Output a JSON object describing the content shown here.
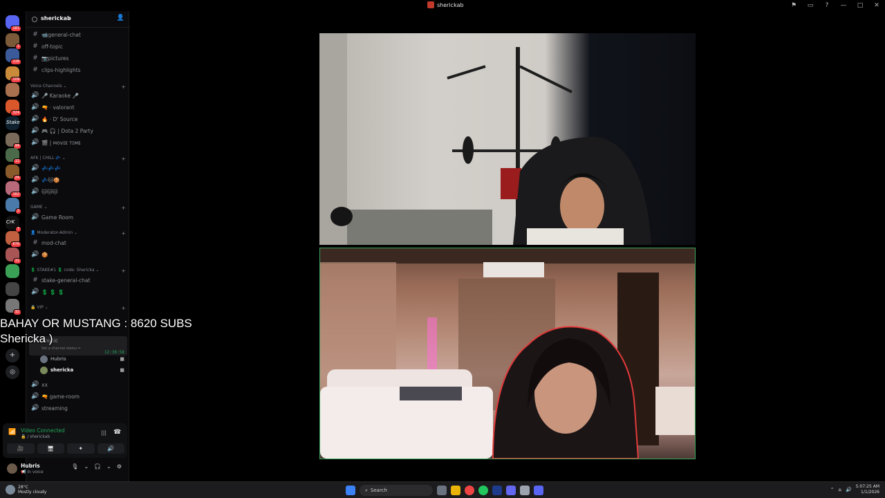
{
  "window": {
    "title": "sherickab",
    "controls": [
      "⚑",
      "▭",
      "?",
      "—",
      "□",
      "✕"
    ]
  },
  "rail": {
    "servers": [
      {
        "name": "home",
        "badge": "181",
        "color": "#5865f2"
      },
      {
        "name": "server-2",
        "badge": "1",
        "color": "#7b5a3a"
      },
      {
        "name": "server-3",
        "badge": "138",
        "color": "#3a5a9a"
      },
      {
        "name": "server-4",
        "badge": "109",
        "color": "#c98a3a"
      },
      {
        "name": "server-5",
        "badge": "",
        "color": "#a8704f"
      },
      {
        "name": "server-6",
        "badge": "324",
        "color": "#d9572b"
      },
      {
        "name": "Stake",
        "badge": "",
        "color": "#0f212e"
      },
      {
        "name": "server-8",
        "badge": "94",
        "color": "#7a6a5a"
      },
      {
        "name": "server-9",
        "badge": "12",
        "color": "#4a6a4a"
      },
      {
        "name": "server-10",
        "badge": "24",
        "color": "#8a5a2a"
      },
      {
        "name": "server-11",
        "badge": "162",
        "color": "#b86a7a"
      },
      {
        "name": "server-12",
        "badge": "2",
        "color": "#4a7aaa"
      },
      {
        "name": "CrK",
        "badge": "7",
        "color": "#111111"
      },
      {
        "name": "server-14",
        "badge": "676",
        "color": "#c06040"
      },
      {
        "name": "server-15",
        "badge": "11",
        "color": "#aa5555"
      },
      {
        "name": "server-16",
        "badge": "",
        "color": "#3aa055"
      },
      {
        "name": "server-17",
        "badge": "",
        "color": "#444444"
      },
      {
        "name": "server-18",
        "badge": "32",
        "color": "#777777"
      }
    ]
  },
  "guild": {
    "name": "sherickab"
  },
  "channels": {
    "text_top": [
      {
        "sym": "#",
        "label": "📹general-chat"
      },
      {
        "sym": "#",
        "label": "off-topic"
      },
      {
        "sym": "#",
        "label": "📷pictures"
      },
      {
        "sym": "#",
        "label": "clips-highlights"
      }
    ],
    "cat_voice": "Voice Channels ⌄",
    "voice": [
      {
        "sym": "🔊",
        "label": "🎤 Karaoke 🎤"
      },
      {
        "sym": "🔊",
        "label": "🔫 · valorant"
      },
      {
        "sym": "🔊",
        "label": "🔥 · D' Source"
      },
      {
        "sym": "🔊",
        "label": "🎮 🎧 | Dota 2 Party"
      },
      {
        "sym": "🔊",
        "label": "🎬 | ᴍᴏᴠɪᴇ ᴛɪᴍᴇ"
      }
    ],
    "cat_afk": "AFK | CHILL 💤 ⌄",
    "afk": [
      {
        "sym": "🔊",
        "label": "💤💤💤"
      },
      {
        "sym": "🔊",
        "label": "💤🐱🍪"
      },
      {
        "sym": "🔊",
        "label": "🐱🐱🐱"
      }
    ],
    "cat_game": "GAME ⌄",
    "game": [
      {
        "sym": "🔊",
        "label": "Game Room"
      }
    ],
    "cat_mod": "👤 Moderator-Admin ⌄",
    "mod": [
      {
        "sym": "#",
        "label": "mod-chat"
      },
      {
        "sym": "🔊",
        "label": "🍪"
      }
    ],
    "cat_stake": "💲 STAKE#1 💲 code: Shericka ⌄",
    "stake": [
      {
        "sym": "#",
        "label": "stake-general-chat"
      },
      {
        "sym": "🔊",
        "label": "💲 💲 💲"
      }
    ],
    "cat_vip": "🔒 VIP ⌄",
    "vip_partial": "music",
    "active_voice": {
      "time": "12:36:58",
      "status_hint": "Set a channel status ✏"
    },
    "voice_users": [
      {
        "name": "Hubris",
        "color": "#6b7280"
      },
      {
        "name": "shericka",
        "color": "#7a8a5a"
      }
    ],
    "bottom": [
      {
        "sym": "🔊",
        "label": "xx"
      },
      {
        "sym": "🔊",
        "label": "🔫 game-room"
      },
      {
        "sym": "🔊",
        "label": "streaming"
      }
    ]
  },
  "voice_panel": {
    "status": "Video Connected",
    "sub": "🔒 / sherickab",
    "buttons": [
      "🎥",
      "🖥",
      "✦",
      "🔊"
    ]
  },
  "user_panel": {
    "name": "Hubris",
    "status": "📢 In voice",
    "controls": [
      "🎙",
      "⌄",
      "🎧",
      "⌄",
      "⚙"
    ]
  },
  "overlay": {
    "line1": "BAHAY OR MUSTANG : 8620 SUBS",
    "line2": "Shericka )"
  },
  "taskbar": {
    "weather": {
      "temp": "28°C",
      "desc": "Mostly cloudy"
    },
    "search": "Search",
    "clock": {
      "time": "5:07:25 AM",
      "date": "1/1/2026"
    }
  }
}
